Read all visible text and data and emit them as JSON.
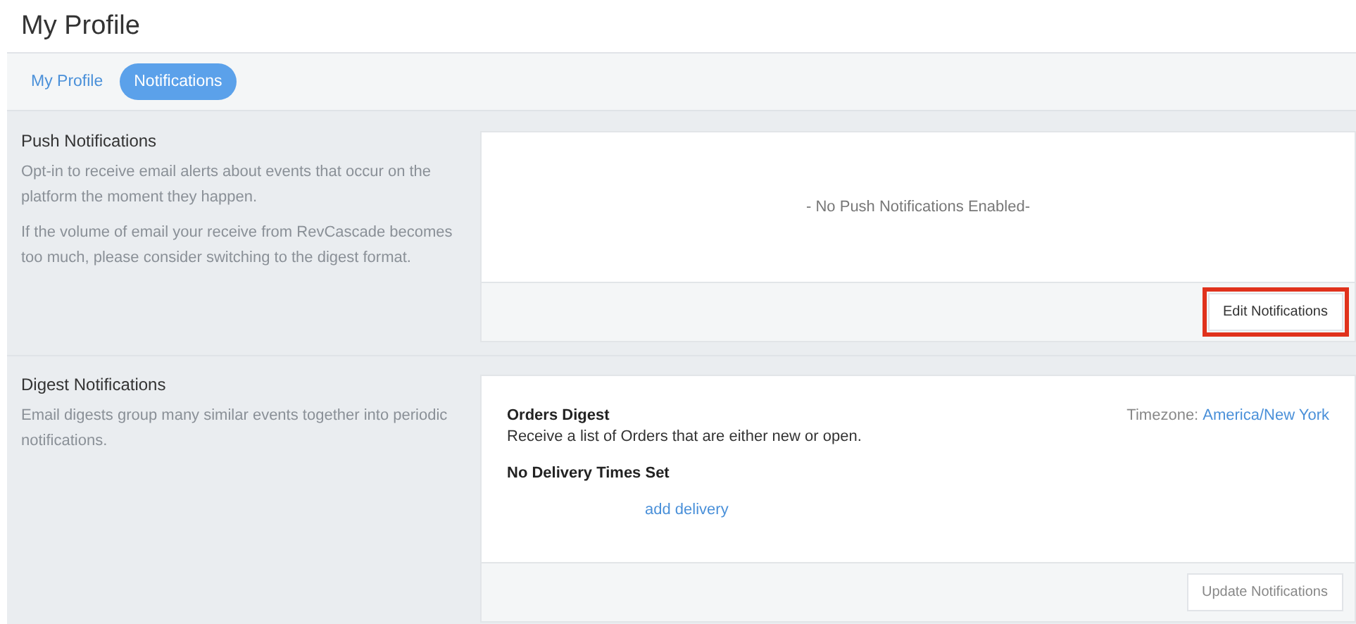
{
  "page_title": "My Profile",
  "tabs": [
    {
      "label": "My Profile",
      "selected": false
    },
    {
      "label": "Notifications",
      "selected": true
    }
  ],
  "sections": [
    {
      "kind": "push",
      "title": "Push Notifications",
      "paragraphs": [
        "Opt-in to receive email alerts about events that occur on the platform the moment they happen.",
        "If the volume of email your receive from RevCascade becomes too much, please consider switching to the digest format."
      ],
      "empty_message": "- No Push Notifications Enabled-",
      "button": {
        "label": "Edit Notifications",
        "disabled": false,
        "highlighted": true
      }
    },
    {
      "kind": "digest",
      "title": "Digest Notifications",
      "paragraphs": [
        "Email digests group many similar events together into periodic notifications."
      ],
      "digest_title": "Orders Digest",
      "digest_description": "Receive a list of Orders that are either new or open.",
      "timezone_label": "Timezone:",
      "timezone_value": "America/New York",
      "delivery_heading": "No Delivery Times Set",
      "add_link": "add delivery",
      "button": {
        "label": "Update Notifications",
        "disabled": true,
        "highlighted": false
      }
    }
  ]
}
